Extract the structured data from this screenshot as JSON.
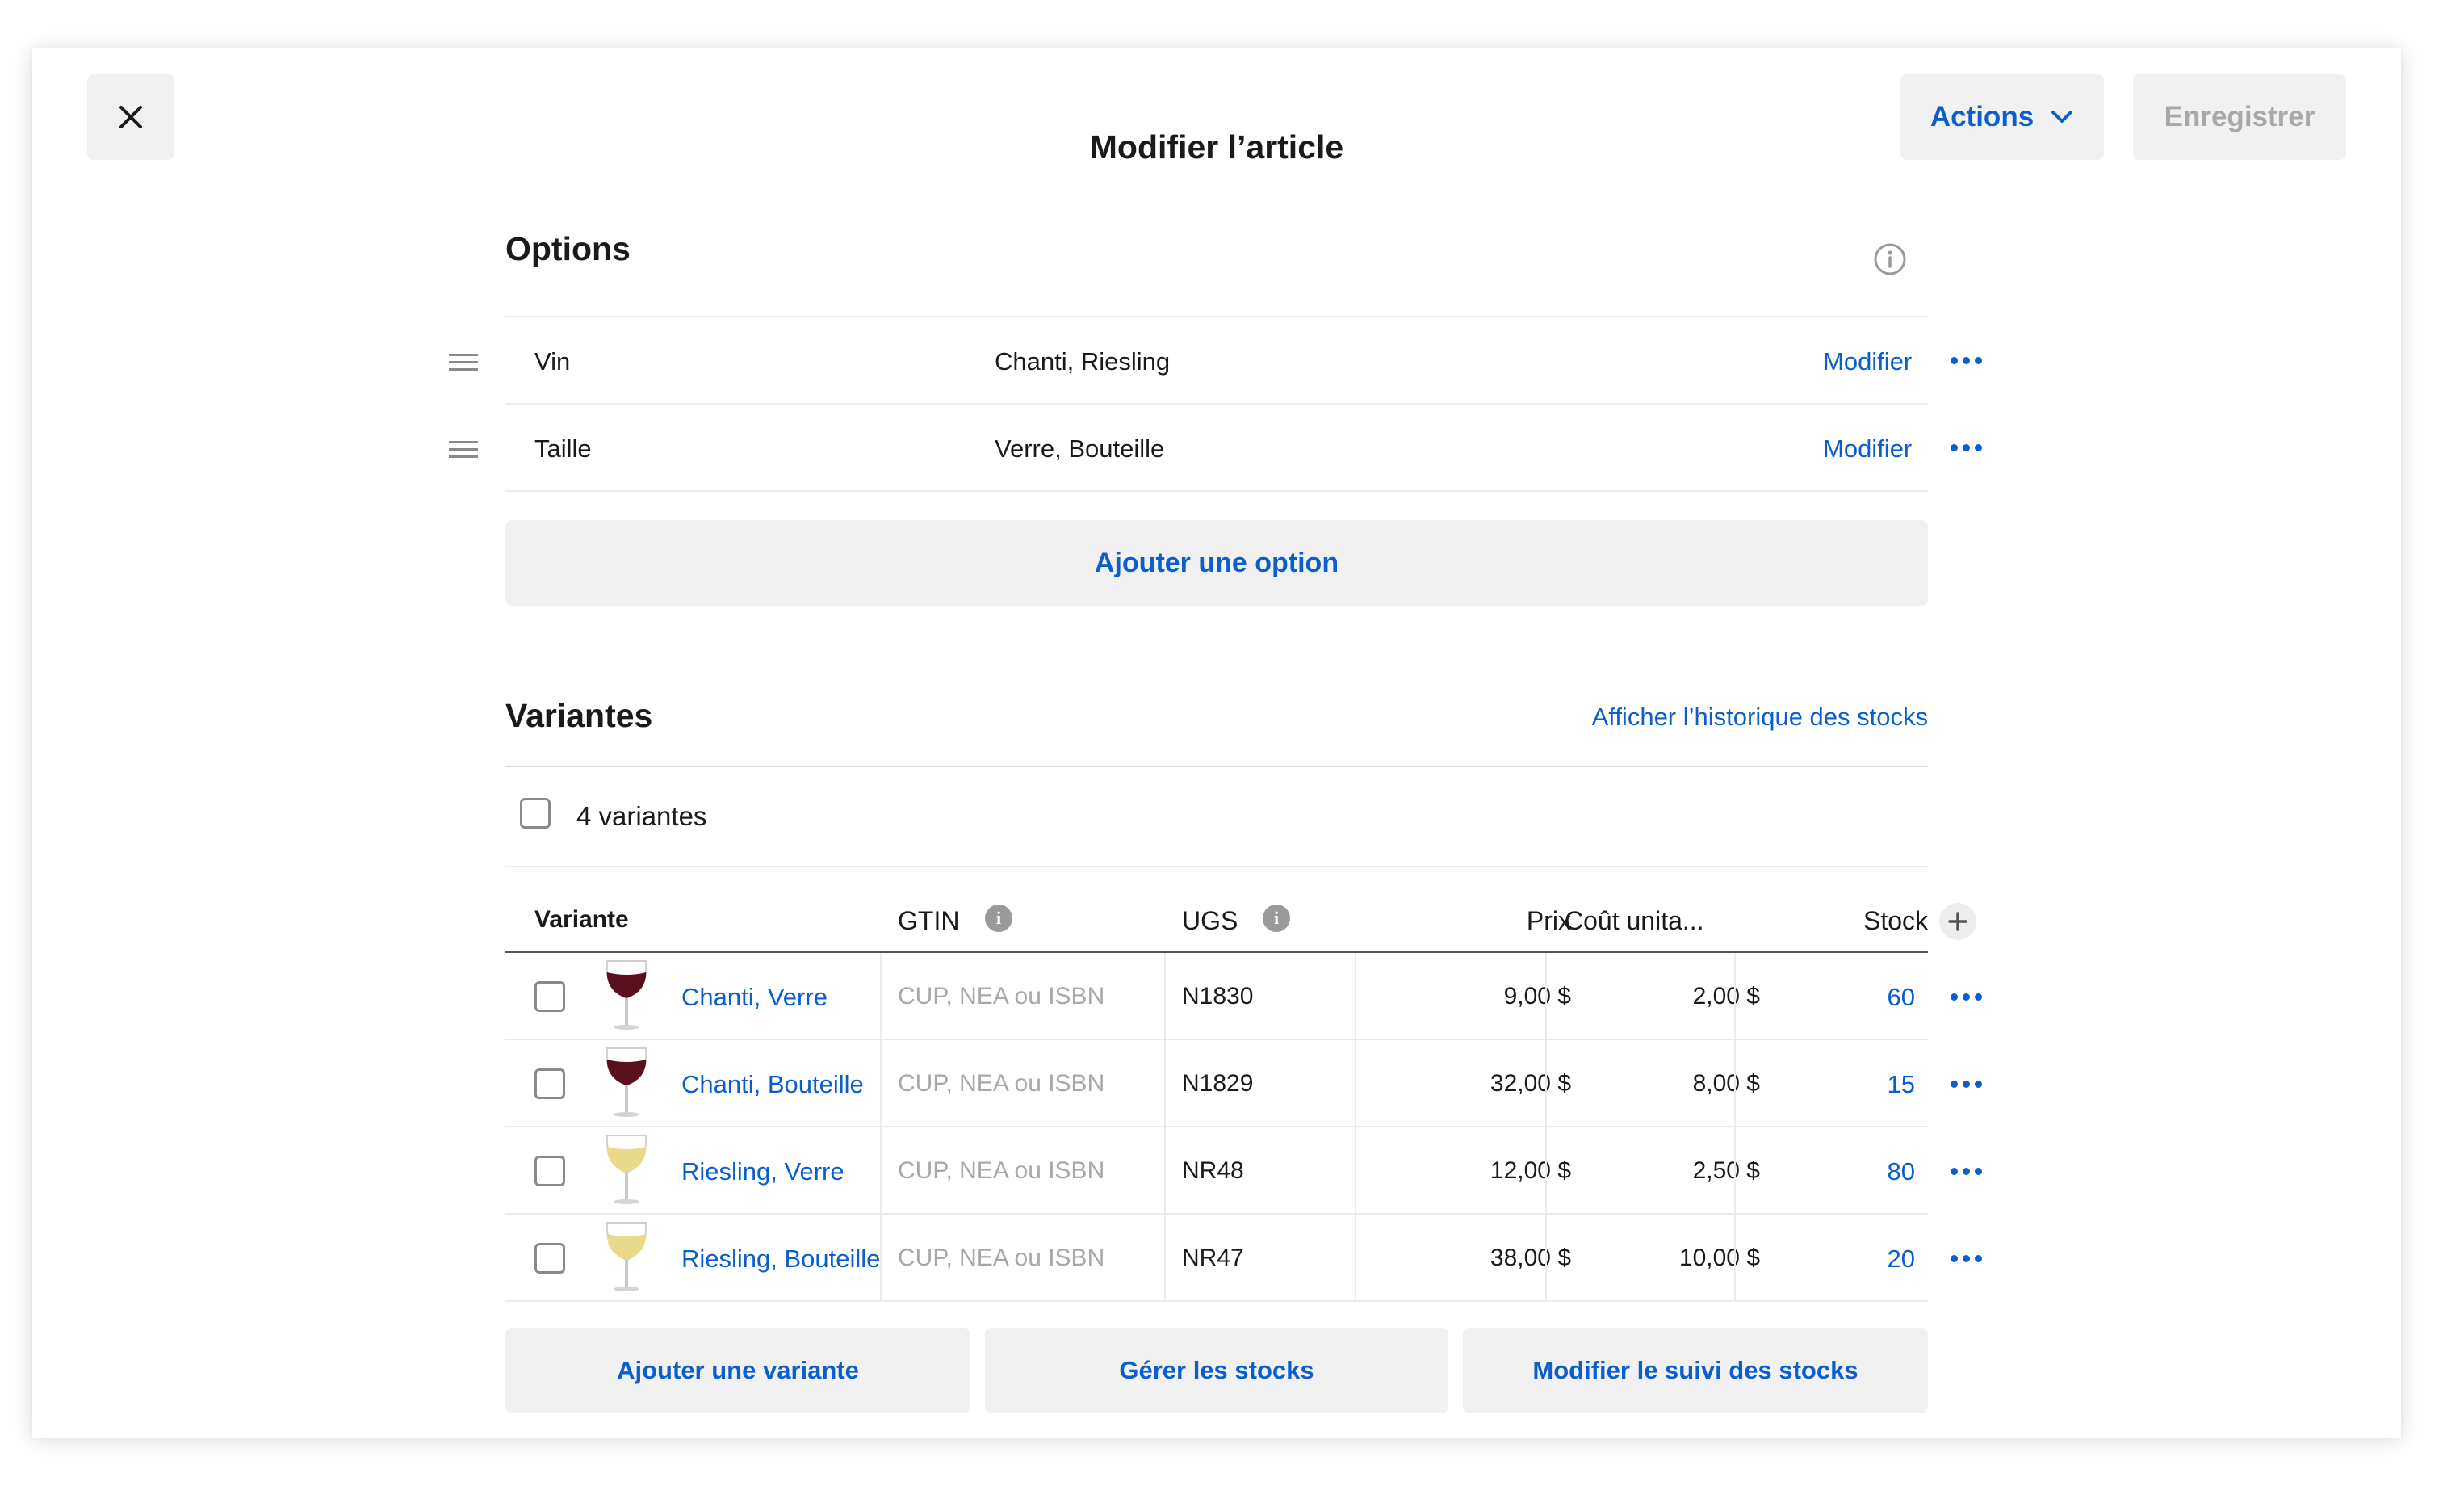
{
  "header": {
    "title": "Modifier l’article",
    "close_icon": "×",
    "actions_label": "Actions",
    "save_label": "Enregistrer"
  },
  "options": {
    "title": "Options",
    "items": [
      {
        "name": "Vin",
        "values": "Chanti, Riesling",
        "edit_label": "Modifier"
      },
      {
        "name": "Taille",
        "values": "Verre, Bouteille",
        "edit_label": "Modifier"
      }
    ],
    "add_label": "Ajouter une option"
  },
  "variants": {
    "title": "Variantes",
    "history_link": "Afficher l’historique des stocks",
    "count_label": "4 variantes",
    "columns": {
      "variant": "Variante",
      "gtin": "GTIN",
      "sku": "UGS",
      "price": "Prix",
      "unit_cost": "Coût unita...",
      "stock": "Stock"
    },
    "gtin_placeholder": "CUP, NEA ou ISBN",
    "rows": [
      {
        "name": "Chanti, Verre",
        "sku": "N1830",
        "price": "9,00 $",
        "cost": "2,00 $",
        "stock": "60",
        "wine_color": "#5a0f1e"
      },
      {
        "name": "Chanti, Bouteille",
        "sku": "N1829",
        "price": "32,00 $",
        "cost": "8,00 $",
        "stock": "15",
        "wine_color": "#5a0f1e"
      },
      {
        "name": "Riesling, Verre",
        "sku": "NR48",
        "price": "12,00 $",
        "cost": "2,50 $",
        "stock": "80",
        "wine_color": "#e9d98a"
      },
      {
        "name": "Riesling, Bouteille",
        "sku": "NR47",
        "price": "38,00 $",
        "cost": "10,00 $",
        "stock": "20",
        "wine_color": "#e9d98a"
      }
    ],
    "buttons": {
      "add_variant": "Ajouter une variante",
      "manage_stock": "Gérer les stocks",
      "edit_tracking": "Modifier le suivi des stocks"
    }
  },
  "colors": {
    "accent": "#0b5fcc",
    "button_bg": "#f1f1f1"
  }
}
